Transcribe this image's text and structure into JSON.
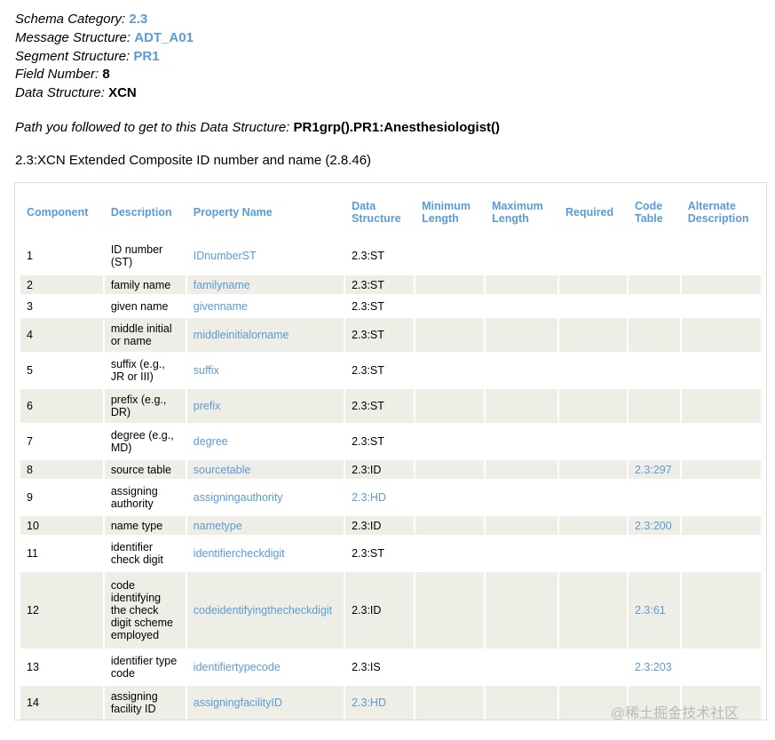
{
  "meta": {
    "schema_category_label": "Schema Category:",
    "schema_category_value": "2.3",
    "message_structure_label": "Message Structure:",
    "message_structure_value": "ADT_A01",
    "segment_structure_label": "Segment Structure:",
    "segment_structure_value": "PR1",
    "field_number_label": "Field Number:",
    "field_number_value": "8",
    "data_structure_label": "Data Structure:",
    "data_structure_value": "XCN"
  },
  "path": {
    "label": "Path you followed to get to this Data Structure:",
    "value": "PR1grp().PR1:Anesthesiologist()"
  },
  "title": "2.3:XCN Extended Composite ID number and name (2.8.46)",
  "table": {
    "headers": {
      "component": "Component",
      "description": "Description",
      "property": "Property Name",
      "ds": "Data Structure",
      "minlen": "Minimum Length",
      "maxlen": "Maximum Length",
      "required": "Required",
      "codetable": "Code Table",
      "altdesc": "Alternate Description"
    },
    "rows": [
      {
        "component": "1",
        "description": "ID number (ST)",
        "property": "IDnumberST",
        "ds": "2.3:ST",
        "codetable": ""
      },
      {
        "component": "2",
        "description": "family name",
        "property": "familyname",
        "ds": "2.3:ST",
        "codetable": ""
      },
      {
        "component": "3",
        "description": "given name",
        "property": "givenname",
        "ds": "2.3:ST",
        "codetable": ""
      },
      {
        "component": "4",
        "description": "middle initial or name",
        "property": "middleinitialorname",
        "ds": "2.3:ST",
        "codetable": ""
      },
      {
        "component": "5",
        "description": "suffix (e.g., JR or III)",
        "property": "suffix",
        "ds": "2.3:ST",
        "codetable": ""
      },
      {
        "component": "6",
        "description": "prefix (e.g., DR)",
        "property": "prefix",
        "ds": "2.3:ST",
        "codetable": ""
      },
      {
        "component": "7",
        "description": "degree (e.g., MD)",
        "property": "degree",
        "ds": "2.3:ST",
        "codetable": ""
      },
      {
        "component": "8",
        "description": "source table",
        "property": "sourcetable",
        "ds": "2.3:ID",
        "codetable": "2.3:297"
      },
      {
        "component": "9",
        "description": "assigning authority",
        "property": "assigningauthority",
        "ds": "2.3:HD",
        "codetable": ""
      },
      {
        "component": "10",
        "description": "name type",
        "property": "nametype",
        "ds": "2.3:ID",
        "codetable": "2.3:200"
      },
      {
        "component": "11",
        "description": "identifier check digit",
        "property": "identifiercheckdigit",
        "ds": "2.3:ST",
        "codetable": ""
      },
      {
        "component": "12",
        "description": "code identifying the check digit scheme employed",
        "property": "codeidentifyingthecheckdigit",
        "ds": "2.3:ID",
        "codetable": "2.3:61"
      },
      {
        "component": "13",
        "description": "identifier type code",
        "property": "identifiertypecode",
        "ds": "2.3:IS",
        "codetable": "2.3:203"
      },
      {
        "component": "14",
        "description": "assigning facility ID",
        "property": "assigningfacilityID",
        "ds": "2.3:HD",
        "codetable": ""
      }
    ]
  },
  "watermark": "@稀土掘金技术社区"
}
